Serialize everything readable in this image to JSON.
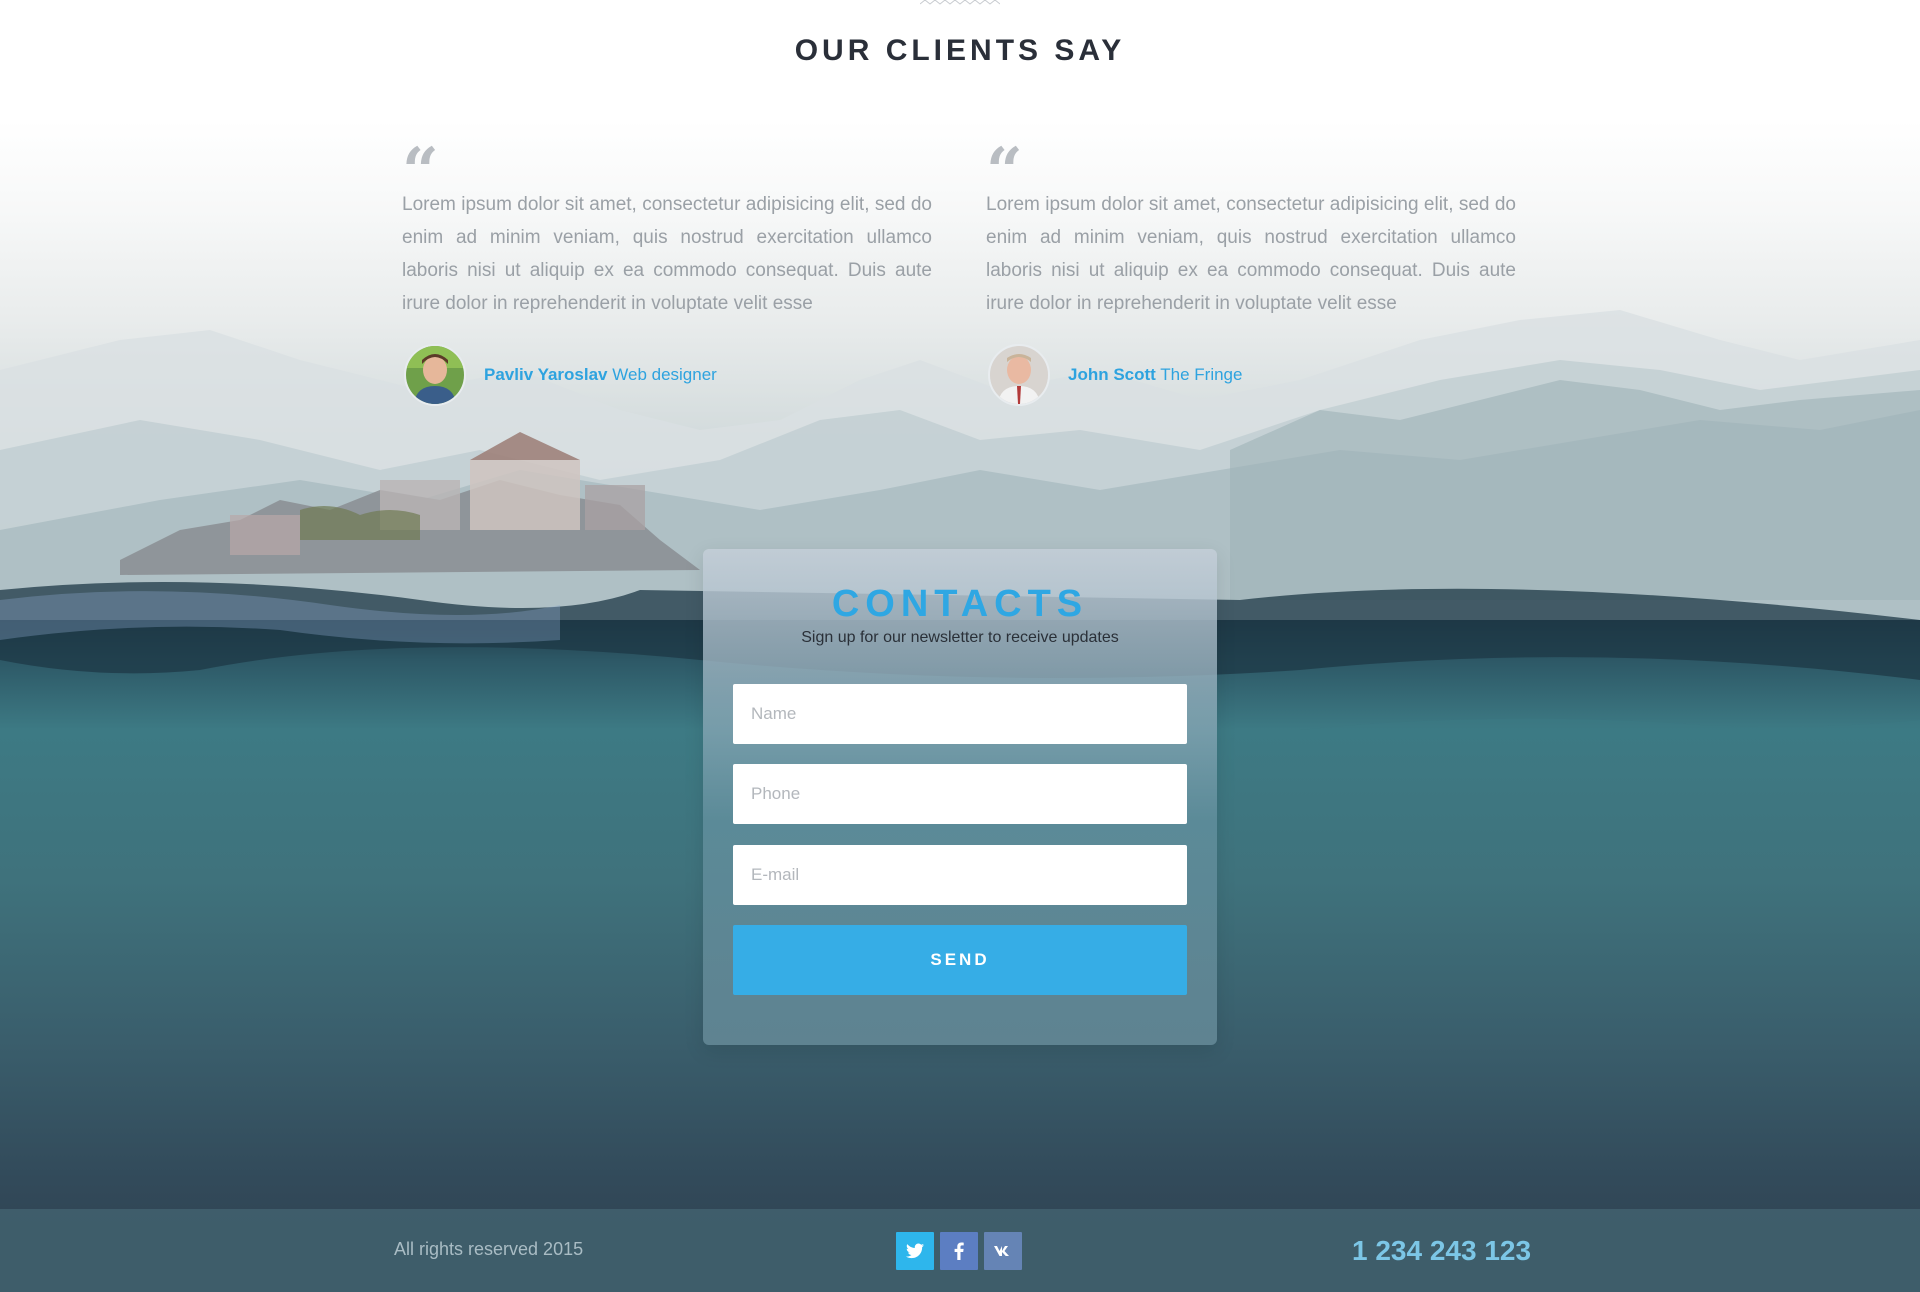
{
  "colors": {
    "accent": "#2fa7e3",
    "button": "#36ade6",
    "title": "#2a2f39",
    "footer_bg": "#405f6c",
    "phone": "#7cc6e6",
    "twitter": "#2eb6ec",
    "facebook": "#5c7ec2",
    "vk": "#6584b5"
  },
  "clients": {
    "title": "OUR CLIENTS SAY",
    "testimonials": [
      {
        "quote_icon": "“",
        "text": "Lorem ipsum dolor sit amet, consectetur adipisicing elit, sed do enim ad minim veniam, quis nostrud exercitation ullamco laboris nisi ut aliquip ex ea commodo consequat. Duis aute irure dolor in reprehenderit in voluptate velit esse",
        "name": "Pavliv Yaroslav",
        "role": "Web designer"
      },
      {
        "quote_icon": "“",
        "text": "Lorem ipsum dolor sit amet, consectetur adipisicing elit, sed do enim ad minim veniam, quis nostrud exercitation ullamco laboris nisi ut aliquip ex ea commodo consequat. Duis aute irure dolor in reprehenderit in voluptate velit esse",
        "name": "John Scott",
        "role": "The Fringe"
      }
    ]
  },
  "contacts": {
    "title": "CONTACTS",
    "subtitle": "Sign up for our newsletter to receive updates",
    "name_placeholder": "Name",
    "phone_placeholder": "Phone",
    "email_placeholder": "E-mail",
    "send_label": "SEND"
  },
  "footer": {
    "copyright": "All rights reserved 2015",
    "socials": [
      "twitter-icon",
      "facebook-icon",
      "vk-icon"
    ],
    "phone": "1 234 243 123"
  }
}
